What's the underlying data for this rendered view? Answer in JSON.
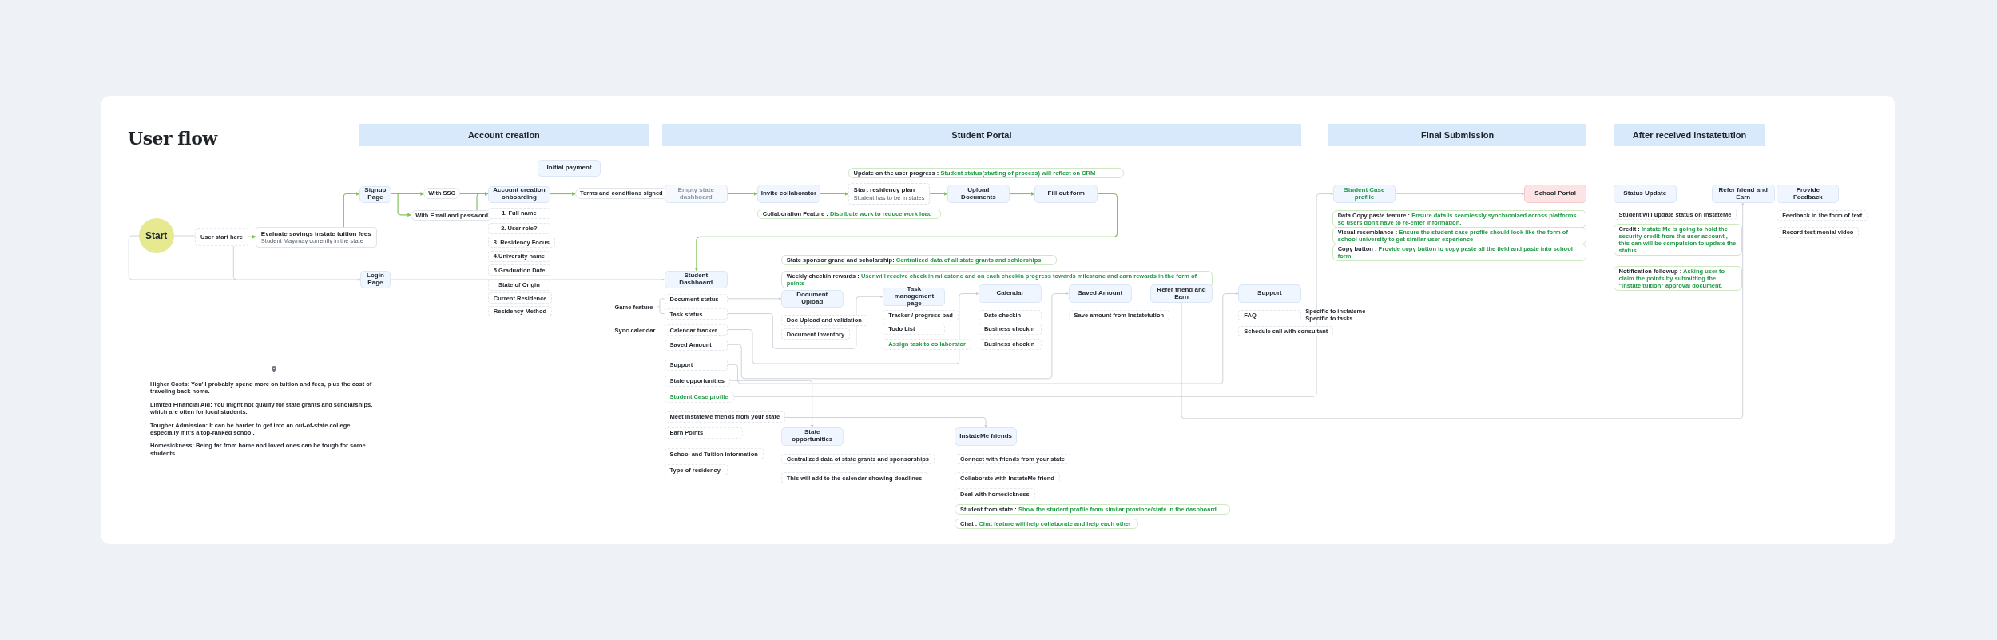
{
  "title": "User flow",
  "sections": [
    {
      "title": "Account creation"
    },
    {
      "title": "Student Portal"
    },
    {
      "title": "Final Submission"
    },
    {
      "title": "After received instatetution"
    }
  ],
  "nodes": [
    {
      "kind": "start",
      "label": "Start"
    },
    {
      "kind": "field",
      "label": "User start here"
    },
    {
      "kind": "info",
      "label": "Evaluate savings instate tuition fees",
      "sublabel": "Student May/may currently in the state"
    },
    {
      "kind": "step",
      "label": "Signup Page"
    },
    {
      "kind": "pill",
      "label": "With SSO"
    },
    {
      "kind": "pill",
      "label": "With Email and password"
    },
    {
      "kind": "step",
      "label": "Account creation onboarding"
    },
    {
      "kind": "step",
      "label": "Initial payment"
    },
    {
      "kind": "pill",
      "label": "Terms and conditions signed"
    },
    {
      "kind": "field",
      "label": "1. Full name"
    },
    {
      "kind": "field",
      "label": "2. User role?"
    },
    {
      "kind": "field",
      "label": "3. Residency Focus"
    },
    {
      "kind": "field",
      "label": "4.University name"
    },
    {
      "kind": "field",
      "label": "5.Graduation Date"
    },
    {
      "kind": "field",
      "label": "State of Origin"
    },
    {
      "kind": "field",
      "label": "Current Residence"
    },
    {
      "kind": "field",
      "label": "Residency Method"
    },
    {
      "kind": "step",
      "label": "Login Page"
    },
    {
      "kind": "step-faded",
      "label": "Empty state dashboard"
    },
    {
      "kind": "step",
      "label": "Invite collaborator"
    },
    {
      "kind": "callout",
      "label": "Update on the user progress :",
      "text": "Student status(starting of process) will reflect on CRM"
    },
    {
      "kind": "plan",
      "label": "Start residency plan",
      "sublabel": "Student has to be in states"
    },
    {
      "kind": "step",
      "label": "Upload Documents"
    },
    {
      "kind": "step",
      "label": "Fill out form"
    },
    {
      "kind": "callout",
      "label": "Collaboration Feature :",
      "text": "Distribute work  to reduce work load"
    },
    {
      "kind": "step",
      "label": "Student Dashboard"
    },
    {
      "kind": "item",
      "label": "Document status"
    },
    {
      "kind": "item",
      "label": "Task status"
    },
    {
      "kind": "item",
      "label": "Calendar tracker"
    },
    {
      "kind": "item",
      "label": "Saved Amount"
    },
    {
      "kind": "item",
      "label": "Support"
    },
    {
      "kind": "item",
      "label": "State opportunities"
    },
    {
      "kind": "item-accent",
      "label": "Student Case profile"
    },
    {
      "kind": "item",
      "label": "Meet InstateMe friends from your state"
    },
    {
      "kind": "item",
      "label": "Earn Points"
    },
    {
      "kind": "item",
      "label": "School and Tuition information"
    },
    {
      "kind": "item",
      "label": "Type of residency"
    },
    {
      "kind": "label",
      "label": "Game feature"
    },
    {
      "kind": "label",
      "label": "Sync calendar"
    },
    {
      "kind": "callout",
      "label": "State sponsor grand and scholarship:",
      "text": "Centralized data of all state grants and schlorships"
    },
    {
      "kind": "callout",
      "label": "Weekly checkin rewards :",
      "text": "User will receive check in milestone and on each checkin progress towards milestone and earn rewards in the form of points"
    },
    {
      "kind": "step",
      "label": "Document Upload"
    },
    {
      "kind": "item",
      "label": "Doc Upload and validation"
    },
    {
      "kind": "item",
      "label": "Document inventory"
    },
    {
      "kind": "step",
      "label": "Task management page"
    },
    {
      "kind": "item",
      "label": "Tracker / progress bad"
    },
    {
      "kind": "item",
      "label": "Todo List"
    },
    {
      "kind": "item-accent",
      "label": "Assign task to collaborator"
    },
    {
      "kind": "step",
      "label": "Calendar"
    },
    {
      "kind": "item",
      "label": "Date checkin"
    },
    {
      "kind": "item",
      "label": "Business checkin"
    },
    {
      "kind": "item",
      "label": "Business checkin"
    },
    {
      "kind": "step",
      "label": "Saved Amount"
    },
    {
      "kind": "item",
      "label": "Save amount from Instatetution"
    },
    {
      "kind": "step",
      "label": "Refer friend and Earn"
    },
    {
      "kind": "step",
      "label": "Support"
    },
    {
      "kind": "item",
      "label": "FAQ"
    },
    {
      "kind": "item",
      "label": "Schedule call with consultant"
    },
    {
      "kind": "label",
      "label": "Specific to instateme"
    },
    {
      "kind": "label",
      "label": "Specific to tasks"
    },
    {
      "kind": "step",
      "label": "State opportunities"
    },
    {
      "kind": "item",
      "label": "Centralized data of state grants and sponsorships"
    },
    {
      "kind": "item",
      "label": "This will add to the calendar showing deadlines"
    },
    {
      "kind": "step",
      "label": "InstateMe friends"
    },
    {
      "kind": "item",
      "label": "Connect with friends from your state"
    },
    {
      "kind": "item",
      "label": "Collaborate with InstateMe friend"
    },
    {
      "kind": "item",
      "label": "Deal with homesickness"
    },
    {
      "kind": "callout",
      "label": "Student from state :",
      "text": "Show the student profile from similar province/state in the dashboard"
    },
    {
      "kind": "callout",
      "label": "Chat :",
      "text": "Chat feature will help collaborate and help each other"
    },
    {
      "kind": "step-accent",
      "label": "Student Case profile"
    },
    {
      "kind": "step-alert",
      "label": "School Portal"
    },
    {
      "kind": "callout",
      "label": "Data Copy paste feature :",
      "text": "Ensure data is seamlessly synchronized across platforms so users don't have to re-enter information."
    },
    {
      "kind": "callout",
      "label": "Visual resemblance :",
      "text": "Ensure the student case profile should look like the form of school university to get  similar user experience"
    },
    {
      "kind": "callout",
      "label": "Copy button :",
      "text": "Provide copy button to copy paste all the field and paste into school form"
    },
    {
      "kind": "step",
      "label": "Status Update"
    },
    {
      "kind": "field",
      "label": "Student will update status on instateMe"
    },
    {
      "kind": "callout",
      "label": "Credit :",
      "text": "Instate Me is going to hold the security credit from the user account , this can will be compulsion to update the status"
    },
    {
      "kind": "callout",
      "label": "Notification followup :",
      "text": "Asking user to claim the points by submitting the \"instate tuition\" approval document."
    },
    {
      "kind": "step",
      "label": "Refer friend and Earn"
    },
    {
      "kind": "step",
      "label": "Provide Feedback"
    },
    {
      "kind": "field",
      "label": "Feedback in the form of text"
    },
    {
      "kind": "field",
      "label": "Record testimonial video"
    }
  ],
  "notes": [
    "Higher Costs: You'll probably spend more on tuition and fees, plus the cost of traveling back home.",
    "Limited Financial Aid: You might not qualify for state grants and scholarships, which are often for local students.",
    "Tougher Admission: It can be harder to get into an out-of-state college, especially if it's a top-ranked school.",
    "Homesickness: Being far from home and loved ones can be tough for some students."
  ]
}
